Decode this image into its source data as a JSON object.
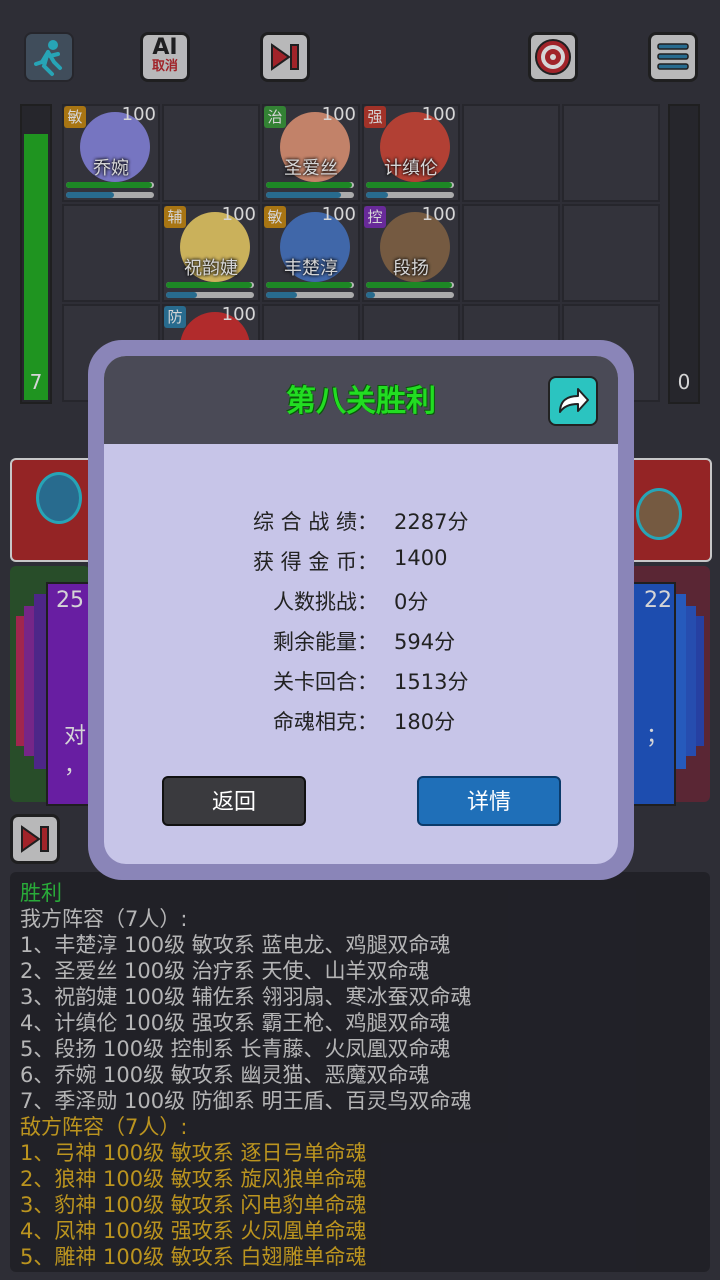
{
  "toolbar": {
    "ai_label_top": "AI",
    "ai_label_bottom": "取消"
  },
  "energy": {
    "left_value": "7",
    "right_value": "0",
    "left_fill": 0.95
  },
  "heroes": [
    {
      "role": "敏",
      "level": "100",
      "name": "乔婉",
      "role_color": "#c98a12",
      "avatar_color": "#8c8ae6",
      "hp": 0.98,
      "mp": 0.55
    },
    {
      "role": "治",
      "level": "100",
      "name": "圣爱丝",
      "role_color": "#3a9a3a",
      "avatar_color": "#e89a7a",
      "hp": 0.98,
      "mp": 0.85
    },
    {
      "role": "强",
      "level": "100",
      "name": "计缜伦",
      "role_color": "#c0392b",
      "avatar_color": "#d54a3a",
      "hp": 0.98,
      "mp": 0.25
    },
    {
      "role": "辅",
      "level": "100",
      "name": "祝韵婕",
      "role_color": "#c98a12",
      "avatar_color": "#f2d36a",
      "hp": 0.98,
      "mp": 0.35
    },
    {
      "role": "敏",
      "level": "100",
      "name": "丰楚淳",
      "role_color": "#c98a12",
      "avatar_color": "#4a79c8",
      "hp": 0.98,
      "mp": 0.35
    },
    {
      "role": "控",
      "level": "100",
      "name": "段扬",
      "role_color": "#7a2fb5",
      "avatar_color": "#8a6a4a",
      "hp": 0.98,
      "mp": 0.1
    },
    {
      "role": "防",
      "level": "100",
      "name": "",
      "role_color": "#2d7ea8",
      "avatar_color": "#d43030",
      "hp": 0.98,
      "mp": 0.2
    }
  ],
  "cards": {
    "left_number": "25",
    "right_number": "22",
    "left_text_1": "对",
    "left_text_2": "，",
    "right_text": "；"
  },
  "modal": {
    "title": "第八关胜利",
    "stats": [
      {
        "label": "综 合 战 绩：",
        "value": "2287分"
      },
      {
        "label": "获 得 金 币：",
        "value": "1400"
      },
      {
        "label": "人数挑战：",
        "value": "0分"
      },
      {
        "label": "剩余能量：",
        "value": "594分"
      },
      {
        "label": "关卡回合：",
        "value": "1513分"
      },
      {
        "label": "命魂相克：",
        "value": "180分"
      }
    ],
    "back_label": "返回",
    "details_label": "详情"
  },
  "log": {
    "result": "胜利",
    "ally_header": "我方阵容（7人）:",
    "ally_lines": [
      "1、丰楚淳 100级 敏攻系 蓝电龙、鸡腿双命魂",
      "2、圣爱丝 100级 治疗系 天使、山羊双命魂",
      "3、祝韵婕 100级 辅佐系 翎羽扇、寒冰蚕双命魂",
      "4、计缜伦 100级 强攻系 霸王枪、鸡腿双命魂",
      "5、段扬 100级 控制系 长青藤、火凤凰双命魂",
      "6、乔婉 100级 敏攻系 幽灵猫、恶魔双命魂",
      "7、季泽勋 100级 防御系 明王盾、百灵鸟双命魂"
    ],
    "enemy_header": "敌方阵容（7人）:",
    "enemy_lines": [
      "1、弓神 100级 敏攻系 逐日弓单命魂",
      "2、狼神 100级 敏攻系 旋风狼单命魂",
      "3、豹神 100级 敏攻系 闪电豹单命魂",
      "4、凤神 100级 强攻系 火凤凰单命魂",
      "5、雕神 100级 敏攻系 白翅雕单命魂"
    ]
  },
  "colors": {
    "log_result": "#2ecc40",
    "log_ally": "#d8d8d8",
    "log_enemy": "#e0b020",
    "title_green": "#22dd22"
  }
}
